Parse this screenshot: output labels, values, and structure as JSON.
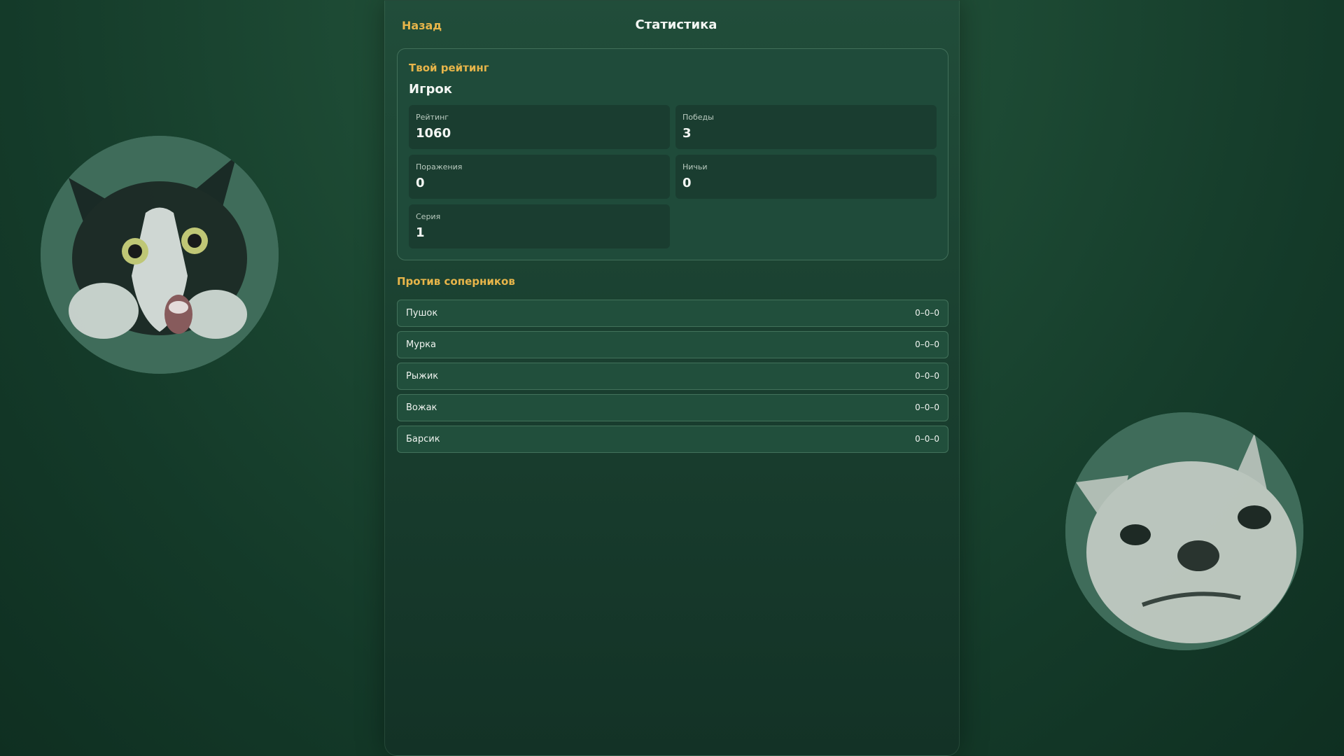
{
  "header": {
    "back_label": "Назад",
    "title": "Статистика"
  },
  "rating": {
    "heading": "Твой рейтинг",
    "player_name": "Игрок",
    "stats": [
      {
        "label": "Рейтинг",
        "value": "1060"
      },
      {
        "label": "Победы",
        "value": "3"
      },
      {
        "label": "Поражения",
        "value": "0"
      },
      {
        "label": "Ничьи",
        "value": "0"
      },
      {
        "label": "Серия",
        "value": "1"
      }
    ]
  },
  "opponents": {
    "heading": "Против соперников",
    "items": [
      {
        "name": "Пушок",
        "record": "0–0–0"
      },
      {
        "name": "Мурка",
        "record": "0–0–0"
      },
      {
        "name": "Рыжик",
        "record": "0–0–0"
      },
      {
        "name": "Вожак",
        "record": "0–0–0"
      },
      {
        "name": "Барсик",
        "record": "0–0–0"
      }
    ]
  },
  "decor": {
    "left_image": "cat-photo",
    "right_image": "dog-photo",
    "accent_color": "#e7b54a",
    "background_color": "#1d4a34"
  }
}
